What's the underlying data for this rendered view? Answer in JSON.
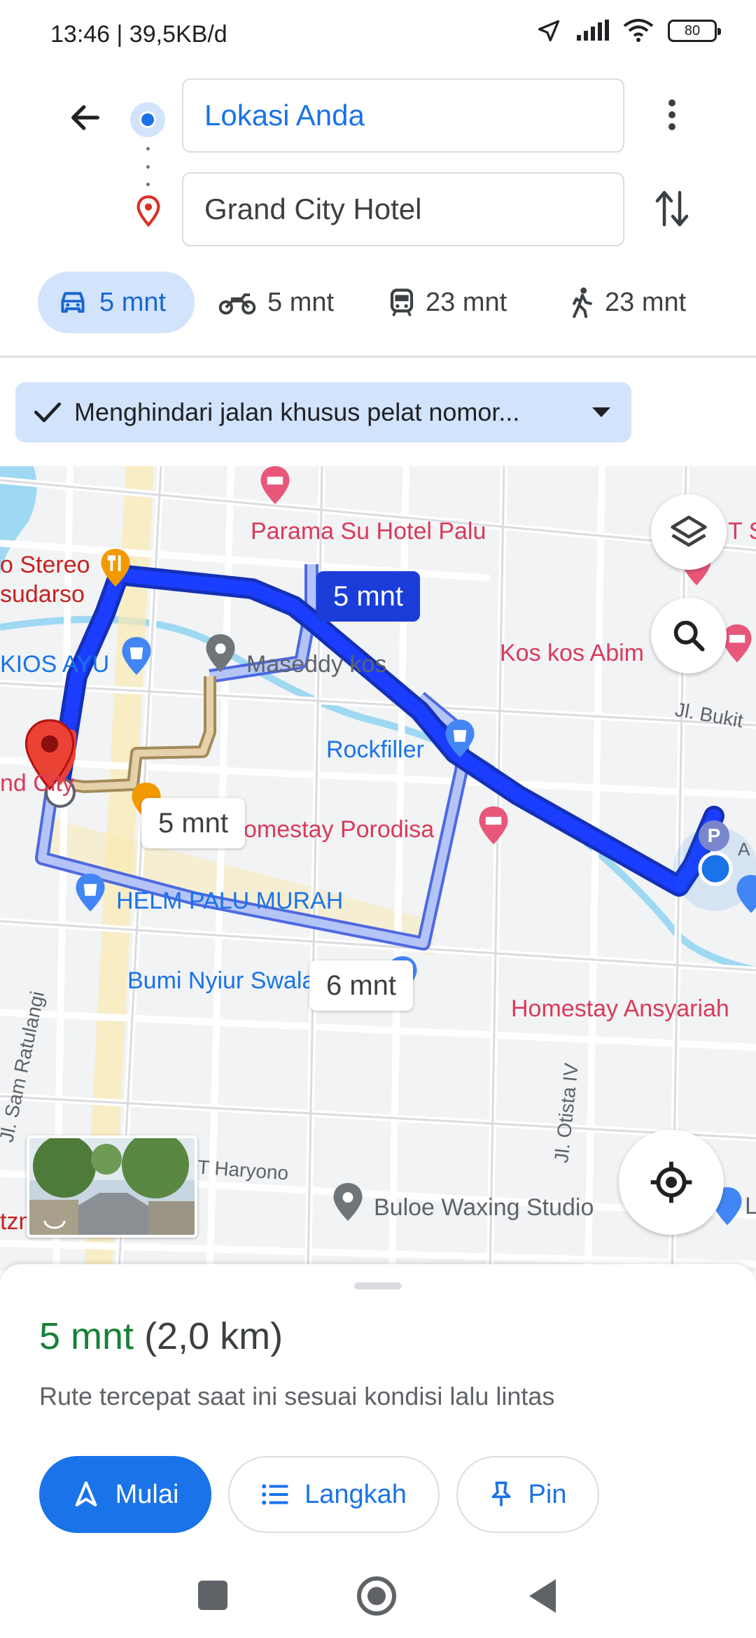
{
  "status_bar": {
    "time": "13:46 | 39,5KB/d",
    "battery": "80"
  },
  "route": {
    "origin": "Lokasi Anda",
    "destination": "Grand City Hotel"
  },
  "modes": [
    {
      "label": "5 mnt",
      "icon": "car-icon"
    },
    {
      "label": "5 mnt",
      "icon": "motorcycle-icon"
    },
    {
      "label": "23 mnt",
      "icon": "train-icon"
    },
    {
      "label": "23 mnt",
      "icon": "walk-icon"
    }
  ],
  "filter_chip": "Menghindari jalan khusus pelat nomor...",
  "map": {
    "places": {
      "parama": "Parama Su Hotel Palu",
      "stereo": "o Stereo",
      "sudarso": "sudarso",
      "kios": "KIOS AYU",
      "maseddy": "Maseddy kos",
      "kos_abim": "Kos kos Abim",
      "bukit": "Jl. Bukit",
      "rockfiller": "Rockfiller",
      "grand_city": "nd City",
      "homestay_porodisa": "omestay Porodisa",
      "helm": "HELM PALU MURAH",
      "bumi_nyiur": "Bumi Nyiur Swalayan",
      "homestay_ansyariah": "Homestay Ansyariah",
      "sam_ratulangi": "Jl. Sam Ratulangi",
      "otista": "Jl. Otista IV",
      "haryono": "T Haryono",
      "buloe": "Buloe Waxing Studio",
      "edge_ts": "T S",
      "edge_a": "A",
      "edge_l": "L",
      "edge_tzn": "tzn",
      "parking": "P"
    },
    "durations": {
      "primary": "5 mnt",
      "alt1": "5 mnt",
      "alt2": "6 mnt"
    }
  },
  "sheet": {
    "time": "5 mnt",
    "distance": "(2,0 km)",
    "subtitle": "Rute tercepat saat ini sesuai kondisi lalu lintas",
    "start_label": "Mulai",
    "steps_label": "Langkah",
    "pin_label": "Pin"
  },
  "colors": {
    "accent": "#1a73e8",
    "route_primary": "#1a3dd9",
    "route_alt": "#a6b8f5",
    "green": "#188038"
  }
}
